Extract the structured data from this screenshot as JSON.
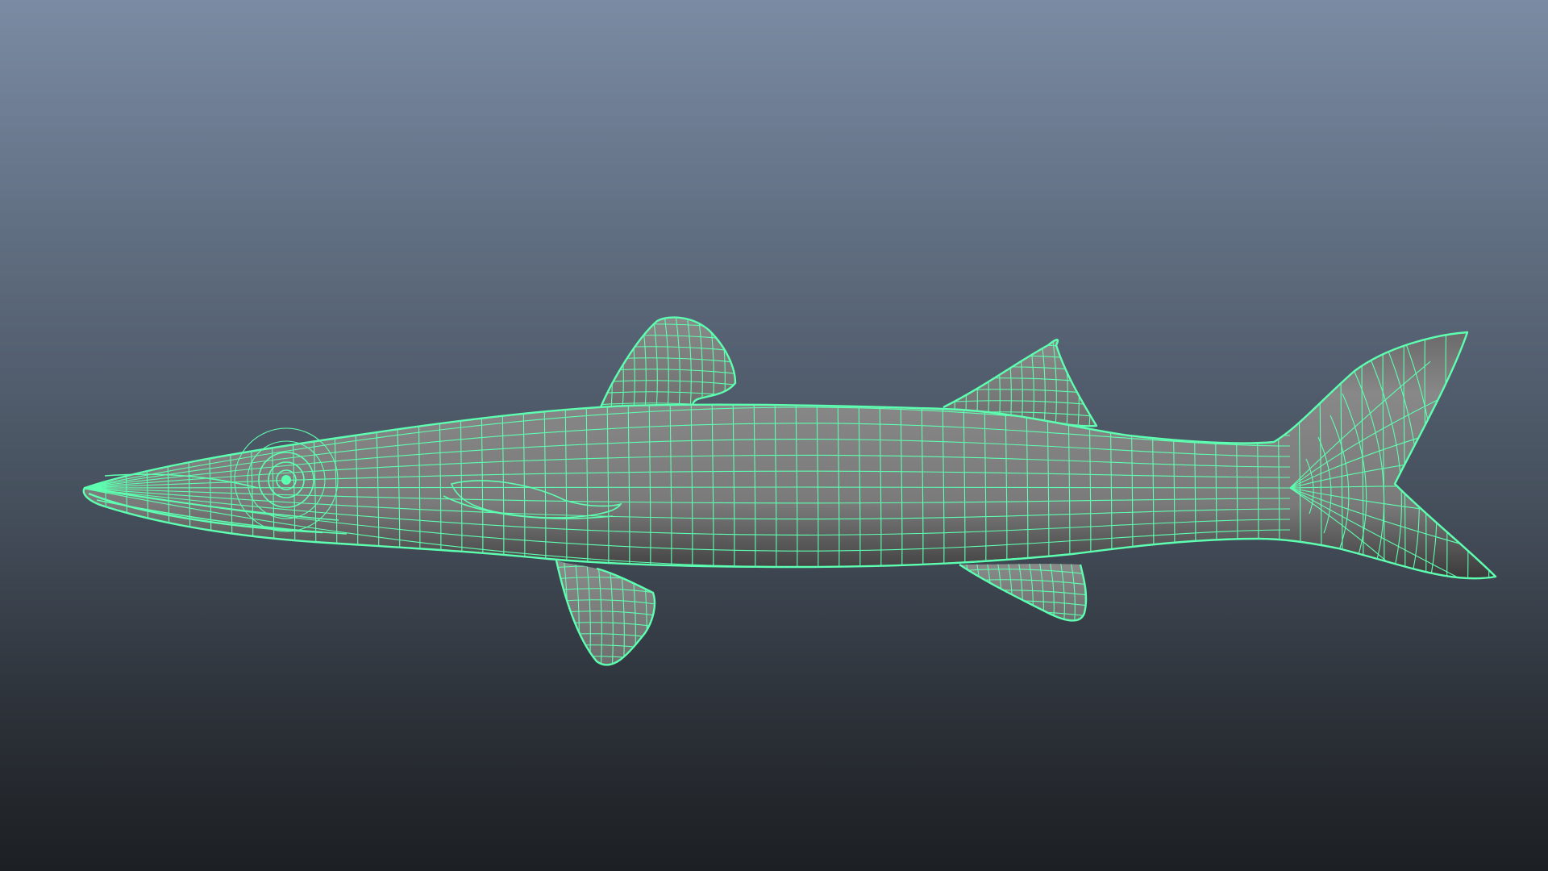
{
  "viewport": {
    "background_top": "#7b8ba3",
    "background_bottom": "#1c1f23"
  },
  "model": {
    "surface_color": "#7c7c7c",
    "wireframe_color": "#5dffb0",
    "display_mode": "wireframe-on-shaded"
  }
}
